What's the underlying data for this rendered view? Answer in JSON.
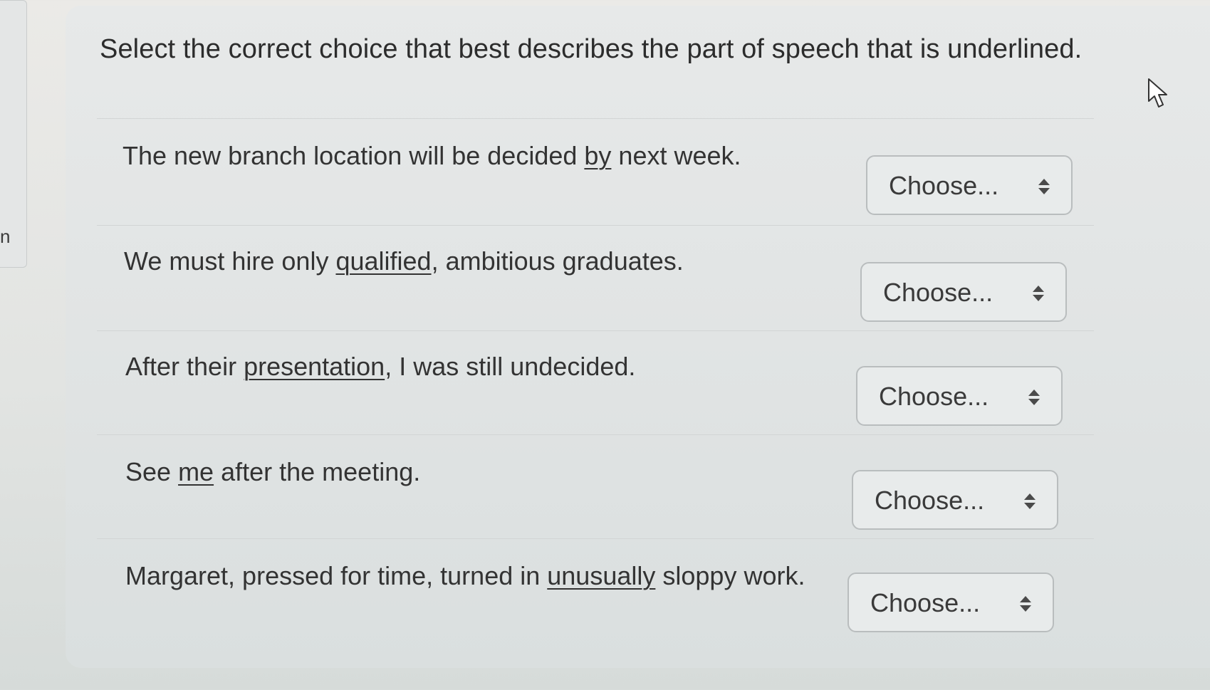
{
  "left_panel": {
    "visible_char": "n"
  },
  "prompt": "Select the correct choice that best describes the part of speech that is underlined.",
  "questions": [
    {
      "before": "The new branch location will be decided ",
      "underlined": "by",
      "after": " next week.",
      "select_value": "Choose..."
    },
    {
      "before": "We must hire only ",
      "underlined": "qualified",
      "after": ", ambitious graduates.",
      "select_value": "Choose..."
    },
    {
      "before": "After their ",
      "underlined": "presentation",
      "after": ", I was still undecided.",
      "select_value": "Choose..."
    },
    {
      "before": "See ",
      "underlined": "me",
      "after": " after the meeting.",
      "select_value": "Choose..."
    },
    {
      "before": "Margaret, pressed for time, turned in ",
      "underlined": "unusually",
      "after": " sloppy work.",
      "select_value": "Choose..."
    }
  ],
  "icons": {
    "select_arrows": "updown-arrows-icon",
    "cursor": "mouse-pointer-icon"
  },
  "colors": {
    "text": "#333333",
    "select_border": "#b9bdbe",
    "select_bg": "#e8ebeb"
  }
}
